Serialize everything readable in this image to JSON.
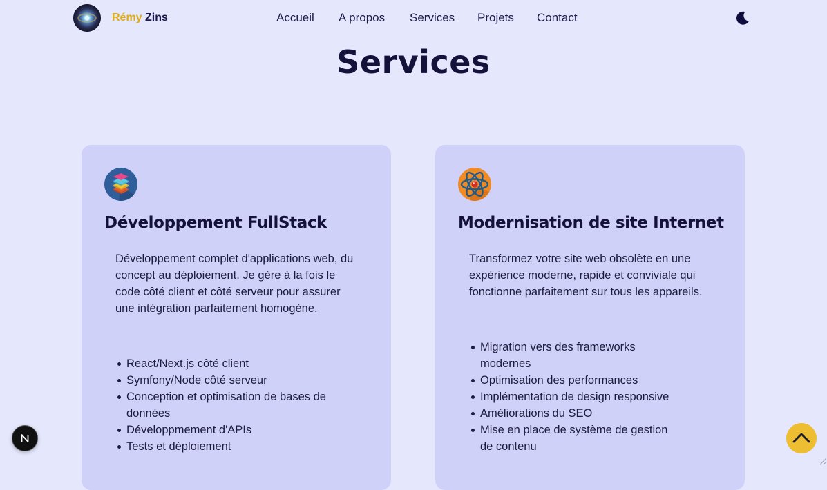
{
  "header": {
    "brand_first": "Rémy",
    "brand_last": "Zins",
    "avatar_icon": "profile-avatar",
    "theme_icon": "moon-icon"
  },
  "nav": {
    "items": [
      {
        "label": "Accueil"
      },
      {
        "label": "A propos"
      },
      {
        "label": "Services"
      },
      {
        "label": "Projets"
      },
      {
        "label": "Contact"
      }
    ]
  },
  "page": {
    "title": "Services"
  },
  "cards": [
    {
      "icon": "stack-layers-icon",
      "title": "Développement FullStack",
      "description": "Développement complet d'applications web, du concept au déploiement. Je gère à la fois le code côté client et côté serveur pour assurer une intégration parfaitement homogène.",
      "items": [
        "React/Next.js côté client",
        "Symfony/Node côté serveur",
        "Conception et optimisation de bases de données",
        "Développmement d'APIs",
        "Tests et déploiement"
      ]
    },
    {
      "icon": "atom-icon",
      "title": "Modernisation de site Internet",
      "description": "Transformez votre site web obsolète en une expérience moderne, rapide et conviviale qui fonctionne parfaitement sur tous les appareils.",
      "items": [
        "Migration vers des frameworks modernes",
        "Optimisation des performances",
        "Implémentation de design responsive",
        "Améliorations du SEO",
        "Mise en place de système de gestion de contenu"
      ]
    }
  ],
  "floating": {
    "dev_badge_icon": "nextjs-icon",
    "scroll_top_icon": "chevron-up-icon"
  },
  "colors": {
    "background": "#e5e7fd",
    "card": "#cfd1f8",
    "accent": "#edbd32",
    "brand_first": "#e0ad16",
    "text": "#14123a"
  }
}
